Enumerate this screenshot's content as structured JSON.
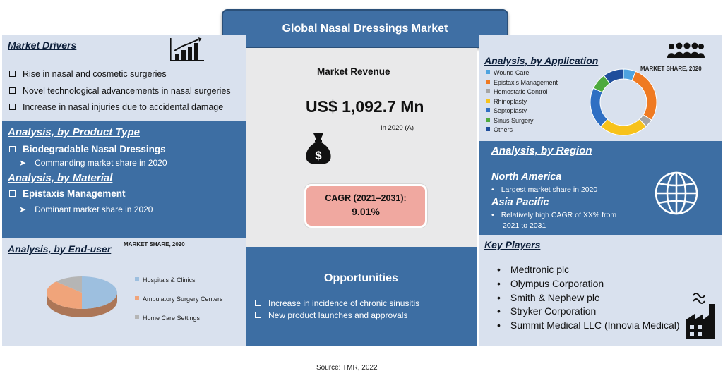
{
  "title": "Global Nasal Dressings Market",
  "source": "Source: TMR, 2022",
  "market_drivers": {
    "heading": "Market Drivers",
    "items": [
      "Rise in nasal and cosmetic surgeries",
      "Novel technological advancements in nasal surgeries",
      "Increase in nasal injuries due to accidental damage"
    ]
  },
  "product_type": {
    "heading": "Analysis, by Product Type",
    "item": "Biodegradable Nasal Dressings",
    "sub": "Commanding market share in 2020"
  },
  "material": {
    "heading": "Analysis, by Material",
    "item": "Epistaxis Management",
    "sub": "Dominant market share in 2020"
  },
  "end_user": {
    "heading": "Analysis, by End-user",
    "market_share_label": "MARKET SHARE, 2020"
  },
  "revenue": {
    "label": "Market Revenue",
    "value": "US$ 1,092.7 Mn",
    "year": "In 2020 (A)"
  },
  "cagr": {
    "label": "CAGR (2021–2031):",
    "value": "9.01%"
  },
  "opportunities": {
    "heading": "Opportunities",
    "items": [
      "Increase in incidence of chronic sinusitis",
      "New product launches and approvals"
    ]
  },
  "application": {
    "heading": "Analysis, by Application",
    "market_share_label": "MARKET SHARE, 2020"
  },
  "region": {
    "heading": "Analysis, by Region",
    "na_name": "North America",
    "na_note": "Largest market share in 2020",
    "ap_name": "Asia Pacific",
    "ap_note_1": "Relatively high CAGR of XX% from",
    "ap_note_2": "2021 to 2031"
  },
  "key_players": {
    "heading": "Key Players",
    "items": [
      "Medtronic plc",
      "Olympus Corporation",
      "Smith & Nephew plc",
      "Stryker Corporation",
      "Summit Medical LLC (Innovia Medical)"
    ]
  },
  "colors": {
    "panel_light": "#d9e1ee",
    "panel_blue": "#3d6ea3",
    "cagr_fill": "#f0a8a0"
  },
  "chart_data": [
    {
      "type": "pie",
      "categories": [
        "Hospitals & Clinics",
        "Ambulatory Surgery Centers",
        "Home Care Settings"
      ],
      "values": [
        50,
        37,
        13
      ],
      "colors": [
        "#9dbfdf",
        "#f0a47a",
        "#b5b5b5"
      ],
      "title": "MARKET SHARE, 2020",
      "legend": "right"
    },
    {
      "type": "pie",
      "categories": [
        "Wound Care",
        "Epistaxis Management",
        "Hemostatic Control",
        "Rhinoplasty",
        "Septoplasty",
        "Sinus Surgery",
        "Others"
      ],
      "values": [
        6,
        28,
        4,
        24,
        20,
        8,
        10
      ],
      "colors": [
        "#4ea3df",
        "#ef7a22",
        "#a5a5a5",
        "#f7c21b",
        "#2f6fc3",
        "#4eaa3e",
        "#1f4e9c"
      ],
      "title": "MARKET SHARE, 2020",
      "legend": "left"
    }
  ]
}
